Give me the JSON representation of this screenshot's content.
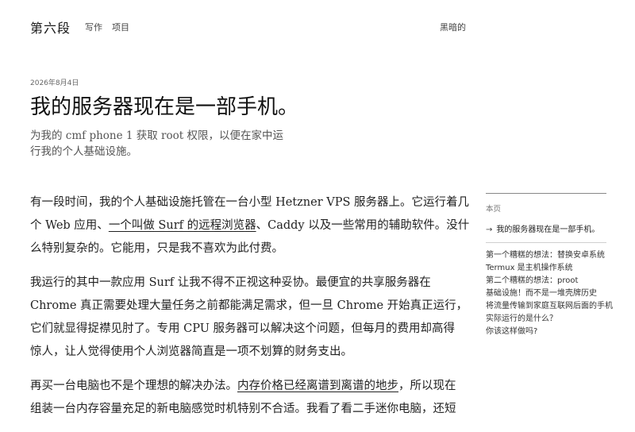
{
  "header": {
    "site_title": "第六段",
    "nav": [
      {
        "label": "写作"
      },
      {
        "label": "项目"
      }
    ],
    "theme_toggle": "黑暗的"
  },
  "post": {
    "date": "2026年8月4日",
    "title": "我的服务器现在是一部手机。",
    "subtitle": "为我的 cmf phone 1 获取 root 权限，以便在家中运行我的个人基础设施。",
    "paragraphs": [
      {
        "lines": [
          "有一段时间，我的个人基础设施托管在一台小型 Hetzner VPS 服务器上。它运行着几",
          [
            "个 Web 应用、",
            {
              "link": "一个叫做 Surf 的远程浏览器"
            },
            "、Caddy 以及一些常用的辅助软件。没什"
          ],
          "么特别复杂的。它能用，只是我不喜欢为此付费。"
        ]
      },
      {
        "lines": [
          "我运行的其中一款应用 Surf 让我不得不正视这种妥协。最便宜的共享服务器在",
          "Chrome 真正需要处理大量任务之前都能满足需求，但一旦 Chrome 开始真正运行，",
          "它们就显得捉襟见肘了。专用 CPU 服务器可以解决这个问题，但每月的费用却高得",
          "惊人，让人觉得使用个人浏览器简直是一项不划算的财务支出。"
        ]
      },
      {
        "lines": [
          [
            "再买一台电脑也不是个理想的解决办法。",
            {
              "link": "内存价格已经离谱到离谱的地步"
            },
            "，所以现在"
          ],
          "组装一台内存容量充足的新电脑感觉时机特别不合适。我看了看二手迷你电脑，还短"
        ]
      }
    ]
  },
  "sidebar": {
    "heading": "本页",
    "current": "我的服务器现在是一部手机。",
    "items": [
      "第一个糟糕的想法：替换安卓系统",
      "Termux 是主机操作系统",
      "第二个糟糕的想法：proot",
      "基础设施！而不是一堆壳牌历史",
      "将流量传输到家庭互联网后面的手机",
      "实际运行的是什么？",
      "你该这样做吗?"
    ]
  }
}
